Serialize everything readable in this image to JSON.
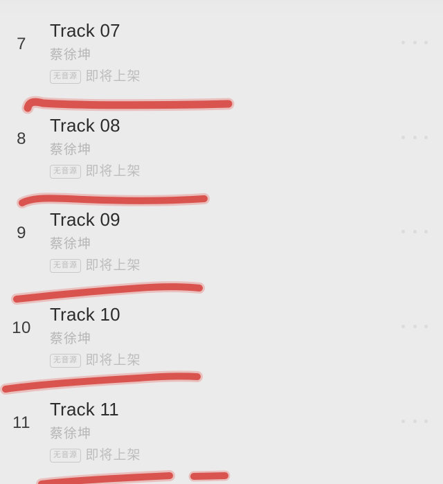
{
  "screen": {
    "background_color": "#ebebeb",
    "title_color": "#2c2c2c",
    "secondary_color": "#bdbdbd",
    "annotation_color": "#d9534f"
  },
  "tracklist": {
    "rows": [
      {
        "index": "7",
        "title": "Track 07",
        "artist": "蔡徐坤",
        "badge": "无音源",
        "status": "即将上架",
        "more_icon": "more-horizontal-icon"
      },
      {
        "index": "8",
        "title": "Track 08",
        "artist": "蔡徐坤",
        "badge": "无音源",
        "status": "即将上架",
        "more_icon": "more-horizontal-icon"
      },
      {
        "index": "9",
        "title": "Track 09",
        "artist": "蔡徐坤",
        "badge": "无音源",
        "status": "即将上架",
        "more_icon": "more-horizontal-icon"
      },
      {
        "index": "10",
        "title": "Track 10",
        "artist": "蔡徐坤",
        "badge": "无音源",
        "status": "即将上架",
        "more_icon": "more-horizontal-icon"
      },
      {
        "index": "11",
        "title": "Track 11",
        "artist": "蔡徐坤",
        "badge": "无音源",
        "status": "即将上架",
        "more_icon": "more-horizontal-icon"
      }
    ]
  },
  "annotations": {
    "count": 5,
    "color": "#d9534f",
    "description": "hand-drawn red underline strokes"
  }
}
